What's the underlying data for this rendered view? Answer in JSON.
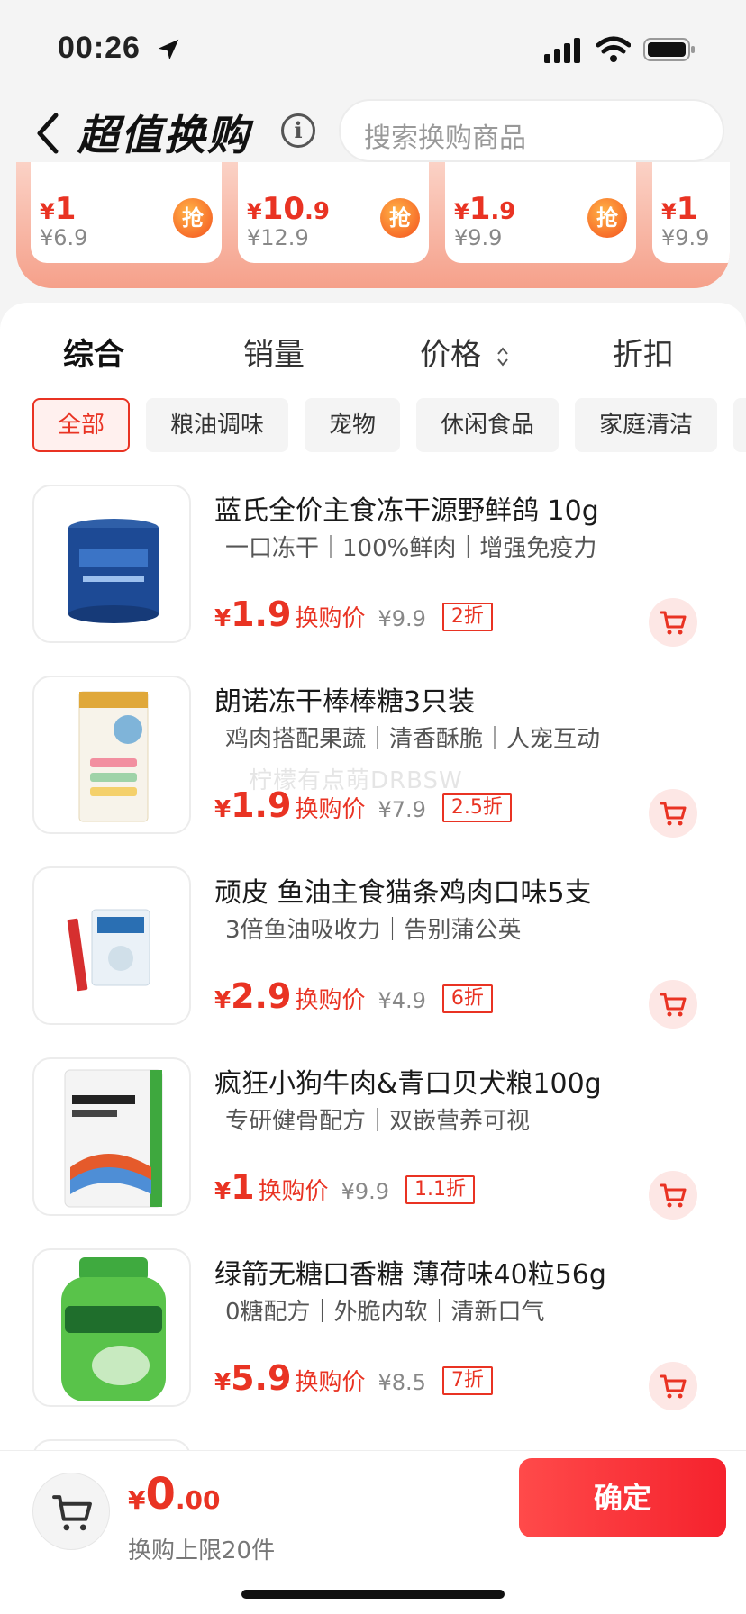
{
  "status": {
    "time": "00:26"
  },
  "header": {
    "title": "超值换购",
    "search_placeholder": "搜索换购商品"
  },
  "promo_cards": [
    {
      "price_int": "1",
      "price_dec": "",
      "orig": "¥6.9",
      "grab": "抢"
    },
    {
      "price_int": "10",
      "price_dec": ".9",
      "orig": "¥12.9",
      "grab": "抢"
    },
    {
      "price_int": "1",
      "price_dec": ".9",
      "orig": "¥9.9",
      "grab": "抢"
    },
    {
      "price_int": "1",
      "price_dec": "",
      "orig": "¥9.9",
      "grab": ""
    }
  ],
  "sort": {
    "items": [
      "综合",
      "销量",
      "价格",
      "折扣"
    ]
  },
  "categories": [
    "全部",
    "粮油调味",
    "宠物",
    "休闲食品",
    "家庭清洁"
  ],
  "products": [
    {
      "name": "蓝氏全价主食冻干源野鲜鸽 10g",
      "tags": "一口冻干｜100%鲜肉｜增强免疫力",
      "price_int": "1",
      "price_dec": ".9",
      "price_label": "换购价",
      "orig": "¥9.9",
      "discount": "2折"
    },
    {
      "name": "朗诺冻干棒棒糖3只装",
      "tags": "鸡肉搭配果蔬｜清香酥脆｜人宠互动",
      "price_int": "1",
      "price_dec": ".9",
      "price_label": "换购价",
      "orig": "¥7.9",
      "discount": "2.5折"
    },
    {
      "name": "顽皮 鱼油主食猫条鸡肉口味5支",
      "tags": "3倍鱼油吸收力｜告别蒲公英",
      "price_int": "2",
      "price_dec": ".9",
      "price_label": "换购价",
      "orig": "¥4.9",
      "discount": "6折"
    },
    {
      "name": "疯狂小狗牛肉&青口贝犬粮100g",
      "tags": "专研健骨配方｜双嵌营养可视",
      "price_int": "1",
      "price_dec": "",
      "price_label": "换购价",
      "orig": "¥9.9",
      "discount": "1.1折"
    },
    {
      "name": "绿箭无糖口香糖 薄荷味40粒56g",
      "tags": "0糖配方｜外脆内软｜清新口气",
      "price_int": "5",
      "price_dec": ".9",
      "price_label": "换购价",
      "orig": "¥8.5",
      "discount": "7折"
    }
  ],
  "watermark": "柠檬有点萌DRBSW",
  "bottom": {
    "currency": "¥",
    "total_int": "0",
    "total_dec": ".00",
    "limit_text": "换购上限20件",
    "confirm_label": "确定"
  },
  "colors": {
    "accent": "#e93323",
    "promo_bg": "#f5a08a"
  }
}
